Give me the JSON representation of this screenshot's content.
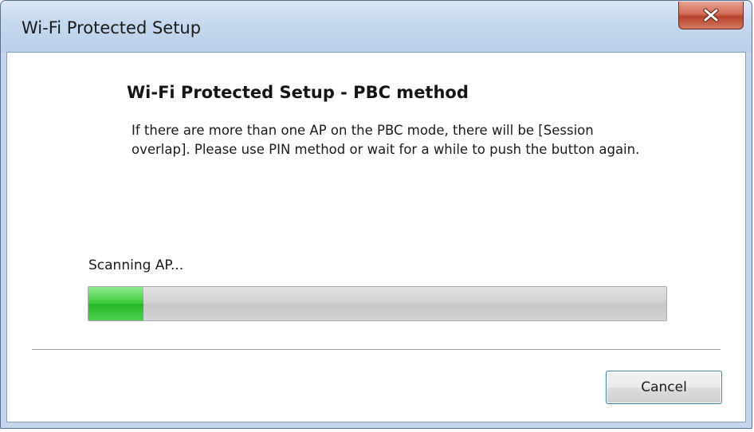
{
  "window": {
    "title": "Wi-Fi Protected Setup",
    "close_icon": "close-icon"
  },
  "content": {
    "heading": "Wi-Fi Protected Setup - PBC method",
    "description": "If there are more than one AP on the PBC mode, there will be [Session overlap]. Please use PIN method or wait for a while to push the button again.",
    "status_text": "Scanning AP...",
    "progress_fraction": 0.095,
    "progress_color": "#3bcb3b"
  },
  "buttons": {
    "cancel_label": "Cancel"
  }
}
